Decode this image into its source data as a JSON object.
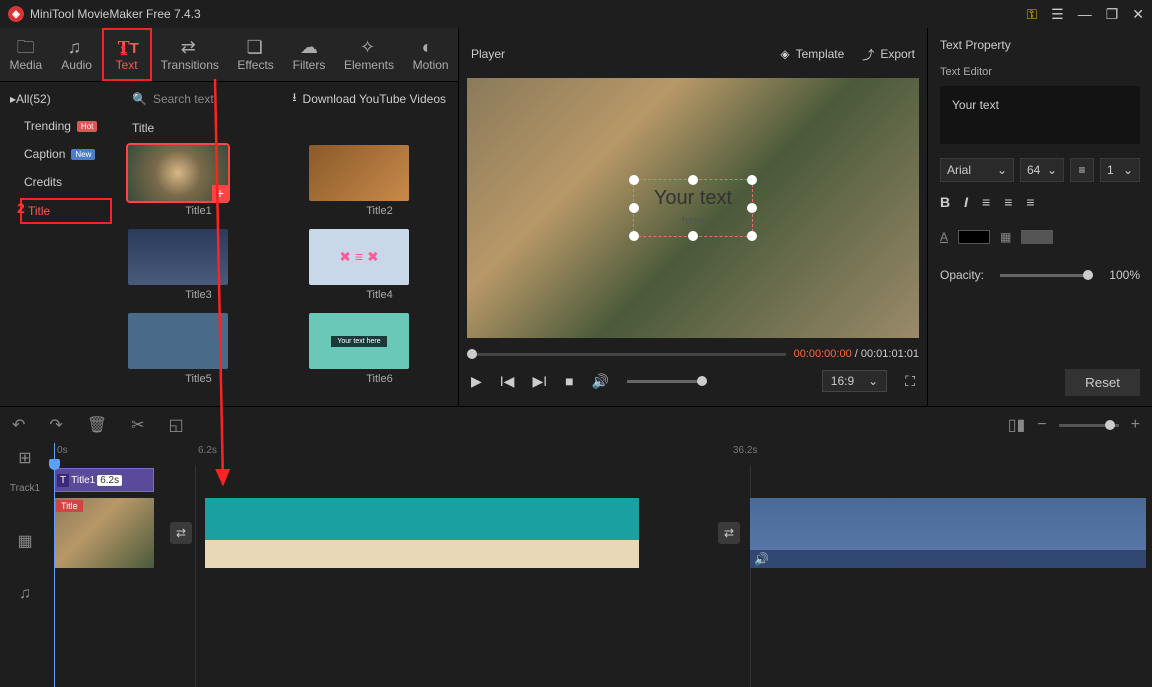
{
  "app": {
    "title": "MiniTool MovieMaker Free 7.4.3"
  },
  "annotations": {
    "one": "1",
    "two": "2"
  },
  "toolbar": {
    "media": "Media",
    "audio": "Audio",
    "text": "Text",
    "transitions": "Transitions",
    "effects": "Effects",
    "filters": "Filters",
    "elements": "Elements",
    "motion": "Motion"
  },
  "sidebar": {
    "all": "All(52)",
    "trending": "Trending",
    "trending_badge": "Hot",
    "caption": "Caption",
    "caption_badge": "New",
    "credits": "Credits",
    "title": "Title"
  },
  "content": {
    "search_placeholder": "Search text",
    "download": "Download YouTube Videos",
    "section": "Title",
    "thumbs": [
      "Title1",
      "Title2",
      "Title3",
      "Title4",
      "Title5",
      "Title6"
    ]
  },
  "player": {
    "label": "Player",
    "template": "Template",
    "export": "Export",
    "preview_text": "Your text",
    "preview_sub": "here",
    "time_current": "00:00:00:00",
    "time_sep": " / ",
    "time_total": "00:01:01:01",
    "aspect": "16:9"
  },
  "properties": {
    "header": "Text Property",
    "editor_label": "Text Editor",
    "text_value": "Your text",
    "font": "Arial",
    "size": "64",
    "line": "1",
    "opacity_label": "Opacity:",
    "opacity_value": "100%",
    "reset": "Reset"
  },
  "timeline": {
    "marks": {
      "m0": "0s",
      "m1": "6.2s",
      "m2": "36.2s"
    },
    "track1": "Track1",
    "title_clip": {
      "label": "Title1",
      "duration": "6.2s"
    },
    "clip1_badge": "Title"
  }
}
